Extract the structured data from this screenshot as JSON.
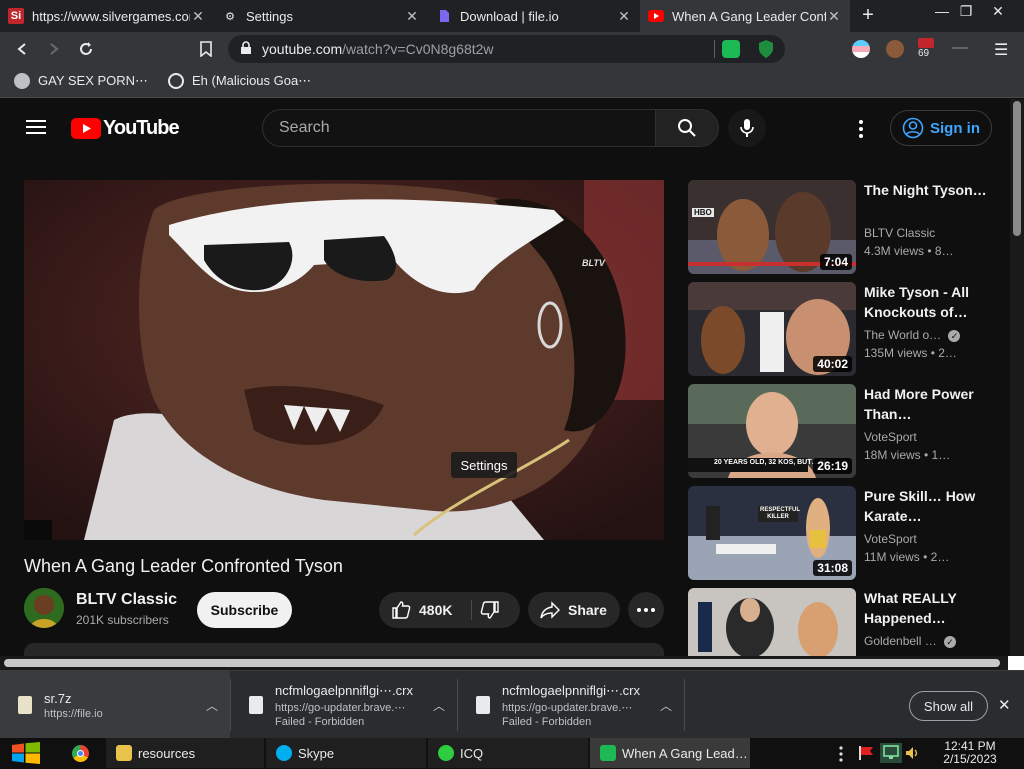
{
  "browser": {
    "tabs": [
      {
        "title": "https://www.silvergames.com",
        "favicon": "Si",
        "active": false
      },
      {
        "title": "Settings",
        "favicon": "gear",
        "active": false
      },
      {
        "title": "Download | file.io",
        "favicon": "file",
        "active": false
      },
      {
        "title": "When A Gang Leader Confronted Tyson",
        "favicon": "youtube",
        "active": true
      }
    ],
    "new_tab": "+",
    "url_host": "youtube.com",
    "url_path": "/watch?v=Cv0N8g68t2w",
    "ext_badge": "69",
    "bookmarks": [
      "GAY SEX PORN⋯",
      "Eh (Malicious Goa⋯"
    ]
  },
  "youtube": {
    "logo": "YouTube",
    "search_placeholder": "Search",
    "signin": "Sign in",
    "video": {
      "watermark": "BLTV",
      "tooltip": "Settings",
      "title": "When A Gang Leader Confronted Tyson",
      "channel": "BLTV Classic",
      "subscribers": "201K subscribers",
      "subscribe": "Subscribe",
      "likes": "480K",
      "share": "Share"
    },
    "recommendations": [
      {
        "title": "The Night Tyson…",
        "channel": "BLTV Classic",
        "views": "4.3M views • 8…",
        "duration": "7:04",
        "verified": false
      },
      {
        "title": "Mike Tyson - All Knockouts of…",
        "channel": "The World o…",
        "views": "135M views • 2…",
        "duration": "40:02",
        "verified": true
      },
      {
        "title": "Had More Power Than…",
        "channel": "VoteSport",
        "views": "18M views • 1…",
        "duration": "26:19",
        "verified": false
      },
      {
        "title": "Pure Skill… How Karate…",
        "channel": "VoteSport",
        "views": "11M views • 2…",
        "duration": "31:08",
        "verified": false
      },
      {
        "title": "What REALLY Happened…",
        "channel": "Goldenbell …",
        "views": "",
        "duration": "",
        "verified": true
      }
    ],
    "thumb_texts": {
      "hbo": "HBO",
      "boxing": "20 YEARS OLD, 32 KOS, BUT… N",
      "karate": "RESPECTFUL KILLER"
    }
  },
  "downloads": [
    {
      "name": "sr.7z",
      "sub1": "https://file.io",
      "sub2": ""
    },
    {
      "name": "ncfmlogaelpnniflgi⋯.crx",
      "sub1": "https://go-updater.brave.⋯",
      "sub2": "Failed - Forbidden"
    },
    {
      "name": "ncfmlogaelpnniflgi⋯.crx",
      "sub1": "https://go-updater.brave.⋯",
      "sub2": "Failed - Forbidden"
    }
  ],
  "downloads_show_all": "Show all",
  "taskbar": {
    "items": [
      "resources",
      "Skype",
      "ICQ",
      "When A Gang Lead…"
    ],
    "time": "12:41 PM",
    "date": "2/15/2023"
  }
}
